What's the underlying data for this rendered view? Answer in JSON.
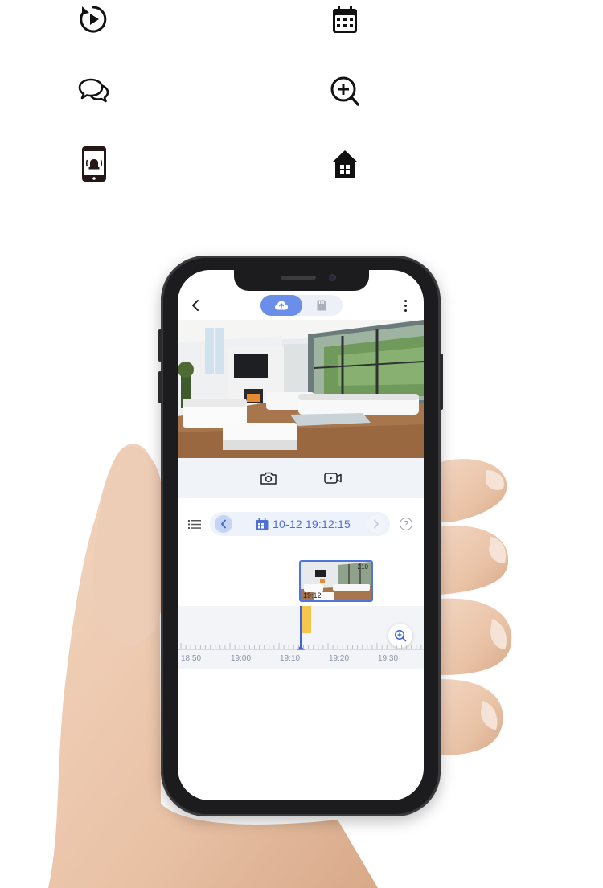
{
  "features": [
    {
      "icon": "replay-icon"
    },
    {
      "icon": "calendar-icon"
    },
    {
      "icon": "chat-bubbles-icon"
    },
    {
      "icon": "zoom-in-icon"
    },
    {
      "icon": "phone-alarm-icon"
    },
    {
      "icon": "home-icon"
    }
  ],
  "app": {
    "storage_tabs": [
      "cloud-icon",
      "sd-card-icon"
    ],
    "active_tab": "cloud",
    "date_time": "10-12 19:12:15",
    "help_label": "?",
    "clip": {
      "time": "19:12",
      "corner": "210"
    },
    "timeline": {
      "labels": [
        "18:50",
        "19:00",
        "19:10",
        "19:20",
        "19:30"
      ],
      "cursor_time": "19:12"
    }
  },
  "colors": {
    "accent": "#4e6fd6",
    "tab_active": "#6b8ee8",
    "event": "#f6c54c",
    "icon": "#111111"
  }
}
